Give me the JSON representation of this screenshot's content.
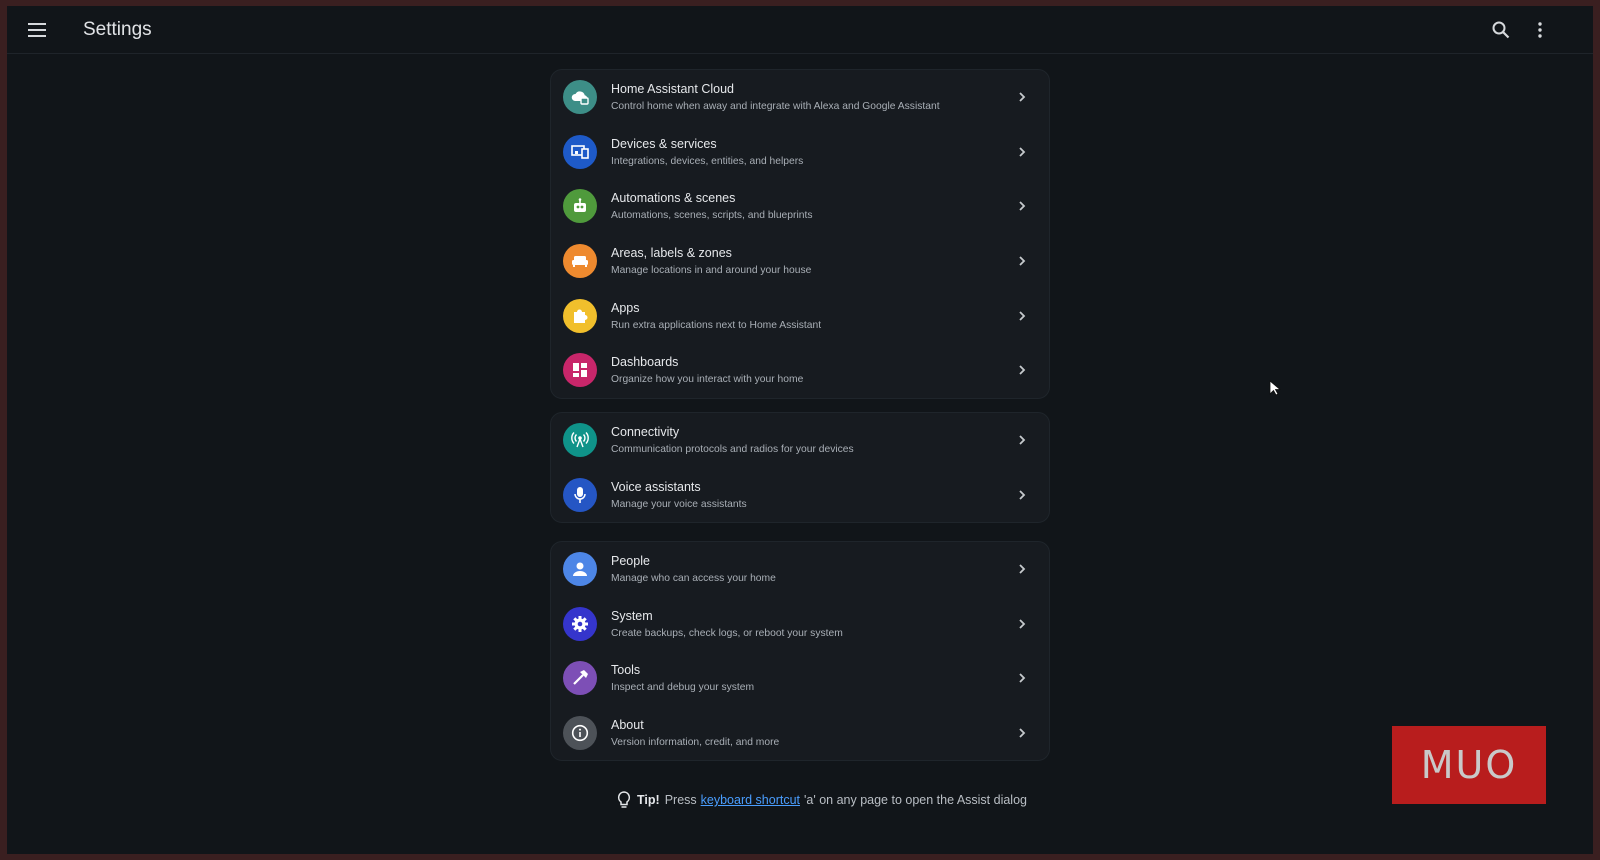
{
  "header": {
    "title": "Settings",
    "icons": {
      "menu": "menu-icon",
      "search": "search-icon",
      "more": "more-vertical-icon"
    }
  },
  "groups": [
    {
      "items": [
        {
          "label": "Home Assistant Cloud",
          "description": "Control home when away and integrate with Alexa and Google Assistant",
          "icon": "cloud-lock-icon",
          "color": "#3d8e87"
        },
        {
          "label": "Devices & services",
          "description": "Integrations, devices, entities, and helpers",
          "icon": "devices-icon",
          "color": "#1e5ac8"
        },
        {
          "label": "Automations & scenes",
          "description": "Automations, scenes, scripts, and blueprints",
          "icon": "robot-icon",
          "color": "#4f9a3c"
        },
        {
          "label": "Areas, labels & zones",
          "description": "Manage locations in and around your house",
          "icon": "sofa-icon",
          "color": "#ee8a2f"
        },
        {
          "label": "Apps",
          "description": "Run extra applications next to Home Assistant",
          "icon": "puzzle-icon",
          "color": "#f1bf2c"
        },
        {
          "label": "Dashboards",
          "description": "Organize how you interact with your home",
          "icon": "dashboard-icon",
          "color": "#c8266a"
        }
      ]
    },
    {
      "items": [
        {
          "label": "Connectivity",
          "description": "Communication protocols and radios for your devices",
          "icon": "antenna-icon",
          "color": "#0f9389"
        },
        {
          "label": "Voice assistants",
          "description": "Manage your voice assistants",
          "icon": "microphone-icon",
          "color": "#2556c4"
        }
      ]
    },
    {
      "items": [
        {
          "label": "People",
          "description": "Manage who can access your home",
          "icon": "person-icon",
          "color": "#4d86e6"
        },
        {
          "label": "System",
          "description": "Create backups, check logs, or reboot your system",
          "icon": "gear-icon",
          "color": "#3535cc"
        },
        {
          "label": "Tools",
          "description": "Inspect and debug your system",
          "icon": "hammer-icon",
          "color": "#7d4fb6"
        },
        {
          "label": "About",
          "description": "Version information, credit, and more",
          "icon": "info-icon",
          "color": "#4d5258"
        }
      ]
    }
  ],
  "tip": {
    "strong": "Tip!",
    "before": "Press",
    "link": "keyboard shortcut",
    "after": "'a' on any page to open the Assist dialog",
    "icon": "lightbulb-icon"
  },
  "watermark": {
    "text": "MUO"
  },
  "colors": {
    "background": "#111519",
    "card": "#171b20",
    "link": "#4a9eff"
  }
}
